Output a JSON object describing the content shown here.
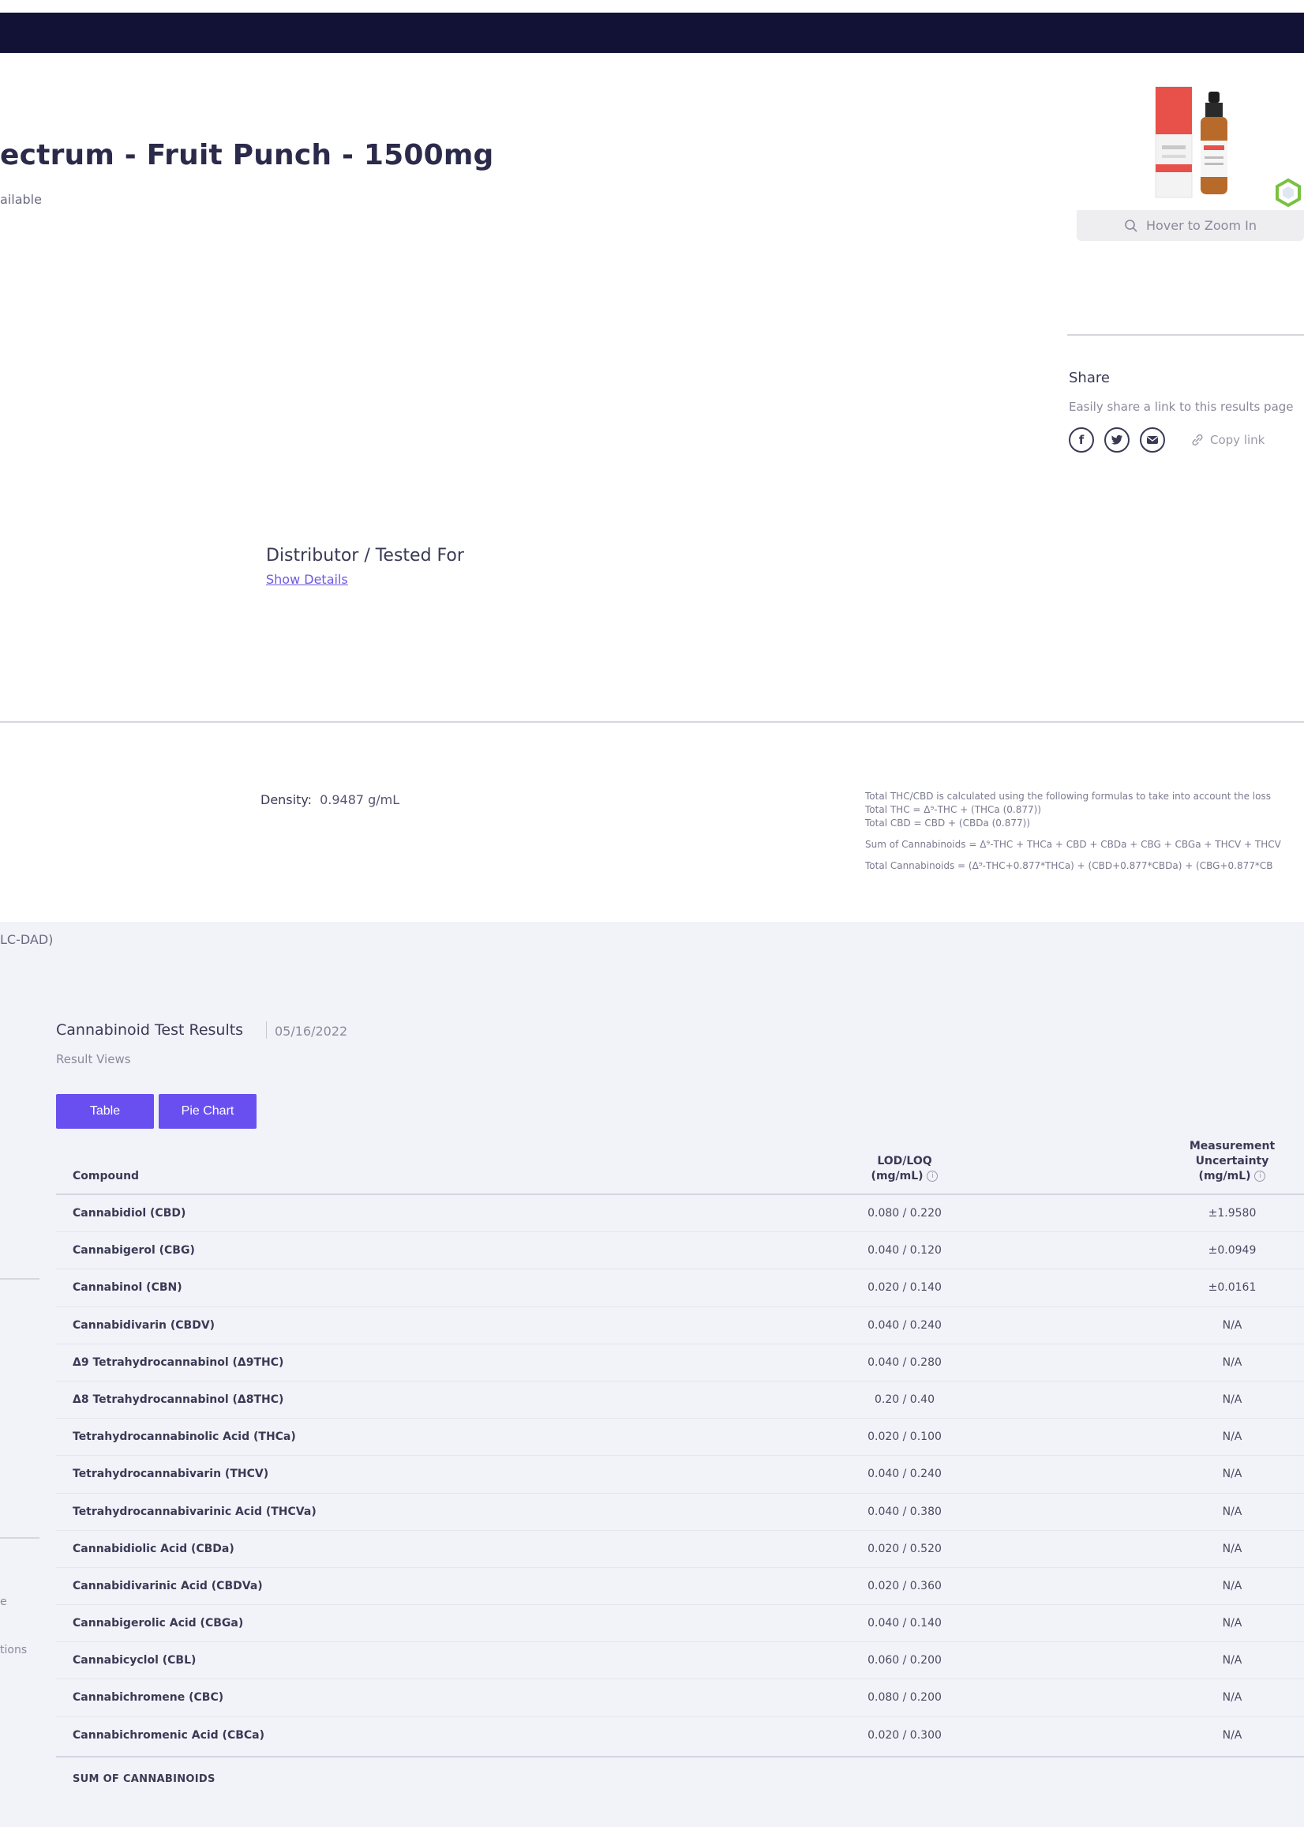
{
  "product": {
    "title": "ectrum - Fruit Punch - 1500mg",
    "subtitle": "ailable",
    "zoom_hint": "Hover to Zoom In"
  },
  "share": {
    "title": "Share",
    "description": "Easily share a link to this results page",
    "icons": [
      "facebook-icon",
      "twitter-icon",
      "email-icon"
    ],
    "copy_link": "Copy link"
  },
  "distributor": {
    "label": "Distributor / Tested For",
    "link": "Show Details"
  },
  "density": {
    "label": "Density:",
    "value": "0.9487 g/mL"
  },
  "formulas": {
    "intro": "Total THC/CBD is calculated using the following formulas to take into account the loss",
    "total_thc": "Total THC = Δ⁹-THC + (THCa (0.877))",
    "total_cbd": "Total CBD = CBD + (CBDa (0.877))",
    "sum": "Sum of Cannabinoids = Δ⁹-THC + THCa + CBD + CBDa + CBG + CBGa + THCV + THCV",
    "total": "Total Cannabinoids = (Δ⁹-THC+0.877*THCa) + (CBD+0.877*CBDa) + (CBG+0.877*CB"
  },
  "method": "LC-DAD)",
  "sidebar": {
    "text_1": "e",
    "text_2": "tions"
  },
  "results": {
    "title": "Cannabinoid Test Results",
    "date": "05/16/2022",
    "views_label": "Result Views",
    "btn_table": "Table",
    "btn_pie": "Pie Chart",
    "headers": {
      "compound": "Compound",
      "lod_line1": "LOD/LOQ",
      "lod_line2": "(mg/mL)",
      "mu_line1": "Measurement",
      "mu_line2": "Uncertainty",
      "mu_line3": "(mg/mL)"
    },
    "rows": [
      {
        "compound": "Cannabidiol (CBD)",
        "lod": "0.080 / 0.220",
        "mu": "±1.9580"
      },
      {
        "compound": "Cannabigerol (CBG)",
        "lod": "0.040 / 0.120",
        "mu": "±0.0949"
      },
      {
        "compound": "Cannabinol (CBN)",
        "lod": "0.020 / 0.140",
        "mu": "±0.0161"
      },
      {
        "compound": "Cannabidivarin (CBDV)",
        "lod": "0.040 / 0.240",
        "mu": "N/A"
      },
      {
        "compound": "Δ9 Tetrahydrocannabinol (Δ9THC)",
        "lod": "0.040 / 0.280",
        "mu": "N/A"
      },
      {
        "compound": "Δ8 Tetrahydrocannabinol (Δ8THC)",
        "lod": "0.20 / 0.40",
        "mu": "N/A"
      },
      {
        "compound": "Tetrahydrocannabinolic Acid (THCa)",
        "lod": "0.020 / 0.100",
        "mu": "N/A"
      },
      {
        "compound": "Tetrahydrocannabivarin (THCV)",
        "lod": "0.040 / 0.240",
        "mu": "N/A"
      },
      {
        "compound": "Tetrahydrocannabivarinic Acid (THCVa)",
        "lod": "0.040 / 0.380",
        "mu": "N/A"
      },
      {
        "compound": "Cannabidiolic Acid (CBDa)",
        "lod": "0.020 / 0.520",
        "mu": "N/A"
      },
      {
        "compound": "Cannabidivarinic Acid (CBDVa)",
        "lod": "0.020 / 0.360",
        "mu": "N/A"
      },
      {
        "compound": "Cannabigerolic Acid (CBGa)",
        "lod": "0.040 / 0.140",
        "mu": "N/A"
      },
      {
        "compound": "Cannabicyclol (CBL)",
        "lod": "0.060 / 0.200",
        "mu": "N/A"
      },
      {
        "compound": "Cannabichromene (CBC)",
        "lod": "0.080 / 0.200",
        "mu": "N/A"
      },
      {
        "compound": "Cannabichromenic Acid (CBCa)",
        "lod": "0.020 / 0.300",
        "mu": "N/A"
      }
    ],
    "sum_label": "SUM OF CANNABINOIDS"
  },
  "colors": {
    "topbar": "#121237",
    "accent": "#6a4ff0",
    "section_bg": "#f1f3f9"
  }
}
